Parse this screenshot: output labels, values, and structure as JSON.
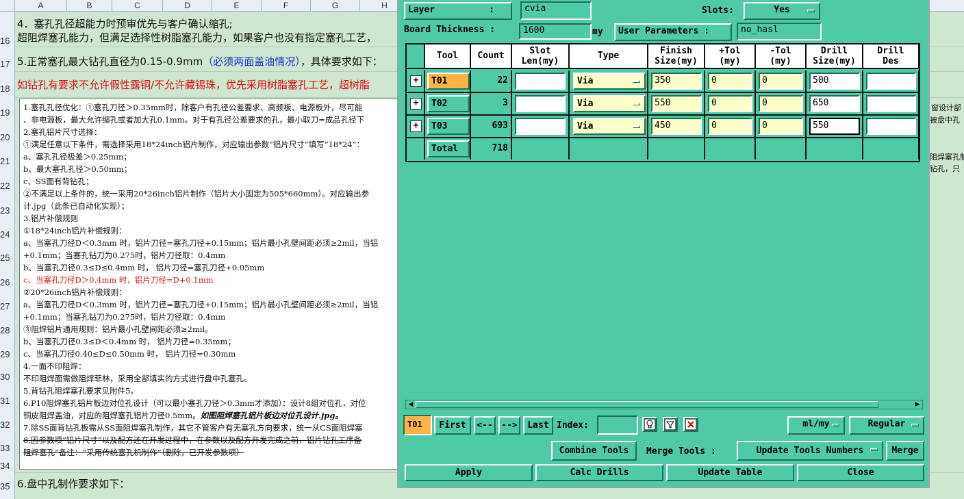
{
  "sheet": {
    "columns": [
      "A",
      "B",
      "C",
      "D",
      "E",
      "F",
      "G",
      "H"
    ],
    "rows": [
      "16",
      "17",
      "18",
      "19",
      "20",
      "21",
      "22",
      "23",
      "24",
      "25",
      "26",
      "27",
      "28",
      "29",
      "30",
      "31",
      "32",
      "33",
      "34",
      "35"
    ],
    "line1": "4．塞孔孔径超能力时预审优先与客户确认缩孔;",
    "line2": "超阻焊塞孔能力，但满足选择性树脂塞孔能力，如果客户也没有指定塞孔工艺，",
    "line3_a": "5.正常塞孔最大钻孔直径为0.15-0.9mm",
    "line3_b": "（必须两面盖油情况）",
    "line3_c": "，具体要求如下：",
    "line4": "如钻孔有要求不允许假性露铜/不允许藏锡珠，优先采用树脂塞孔工艺，超树脂",
    "line5": "6.盘中孔制作要求如下：",
    "notes": [
      "1.塞孔孔径优化：①塞孔刀径＞0.35mm时，除客户有孔径公差要求、高频板、电源板外，尽可能",
      "、非电源板，最大允许缩孔或者加大孔0.1mm。对于有孔径公差要求的孔，最小取刀=成品孔径下",
      "2.塞孔铝片尺寸选择：",
      "①满足任意以下条件，需选择采用18*24inch铝片制作，对应输出参数“铝片尺寸”填写“18*24”：",
      "a、塞孔孔径极差＞0.25mm；",
      "b、最大塞孔孔径＞0.50mm；",
      "c、SS面有背钻孔；",
      "②不满足以上条件的，统一采用20*26inch铝片制作（铝片大小固定为505*660mm）。对应输出参",
      "计.jpg（此条已自动化实现）；",
      "3.铝片补偿规则",
      "①18*24inch铝片补偿规则：",
      "a、当塞孔刀径D＜0.3mm 时，铝片刀径=塞孔刀径+0.15mm；铝片最小孔壁间距必须≥2mil，当铝",
      "+0.1mm；当塞孔钻刀为0.275时，铝片刀径取：0.4mm",
      "b、当塞孔刀径0.3≤D≤0.4mm 时， 铝片刀径=塞孔刀径+0.05mm",
      "c、当塞孔刀径D＞0.4mm 时，铝片刀径=D+0.1mm",
      "②20*26inch铝片补偿规则：",
      "a、当塞孔刀径D＜0.3mm 时，铝片刀径=塞孔刀径+0.15mm；铝片最小孔壁间距必须≥2mil，当铝",
      "+0.1mm；当塞孔钻刀为0.275时，铝片刀径取：0.4mm",
      "③阻焊铝片通用规则：铝片最小孔壁间距必须≥2mil。",
      "b、当塞孔刀径0.3≤D＜0.4mm 时， 铝片刀径=0.35mm；",
      "c、当塞孔刀径0.40≤D≤0.50mm 时， 铝片刀径=0.30mm",
      "4.一面不印阻焊：",
      "不印阻焊面需做阻焊菲林，采用全部填实的方式进行盘中孔塞孔。",
      "5.背钻孔阻焊塞孔要求见附件5。",
      "6.P10阻焊塞孔铝片板边对位孔设计（可以最小塞孔刀径＞0.3mm才添加）：设计8组对位孔，对位",
      "铜皮阻焊盖油，对应的阻焊塞孔铝片刀径0.5mm。",
      "如图阻焊塞孔铝片板边对位孔设计.jpg。",
      "7.除SS面背钻孔板需从SS面阻焊塞孔制作，其它不管客户有无塞孔方向要求，统一从CS面阻焊塞",
      "8.因参数项“铝片尺寸”以及配方还在开发过程中，在参数以及配方开发完成之前，铝片钻孔工序备",
      "阻焊塞孔”备注：“采用传统塞孔机制作”（删除，已开发参数项）"
    ],
    "right_texts": [
      "窗设计部",
      "被盘中孔",
      "阻焊塞孔制",
      "钻孔，只"
    ]
  },
  "dialog": {
    "layer_label": "Layer",
    "layer_value": "cvia",
    "slots_label": "Slots:",
    "slots_value": "Yes",
    "board_thickness_label": "Board Thickness :",
    "board_thickness_value": "1600",
    "board_thickness_unit": "my",
    "user_params_label": "User Parameters :",
    "user_params_value": "no_hasl",
    "table": {
      "headers": [
        "Tool",
        "Count",
        "Slot\nLen(my)",
        "Type",
        "Finish\nSize(my)",
        "+Tol\n(my)",
        "-Tol\n(my)",
        "Drill\nSize(my)",
        "Drill\nDes"
      ],
      "rows": [
        {
          "add": "+",
          "tool": "T01",
          "count": "22",
          "slot_len": "",
          "type": "Via",
          "finish": "350",
          "ptol": "0",
          "ntol": "0",
          "drill": "500",
          "des": ""
        },
        {
          "add": "+",
          "tool": "T02",
          "count": "3",
          "slot_len": "",
          "type": "Via",
          "finish": "550",
          "ptol": "0",
          "ntol": "0",
          "drill": "650",
          "des": ""
        },
        {
          "add": "+",
          "tool": "T03",
          "count": "693",
          "slot_len": "",
          "type": "Via",
          "finish": "450",
          "ptol": "0",
          "ntol": "0",
          "drill": "550",
          "des": ""
        }
      ],
      "total_label": "Total",
      "total_count": "718"
    },
    "nav": {
      "current_tool": "T01",
      "first": "First",
      "prev": "<--",
      "next": "-->",
      "last": "Last",
      "index_label": "Index:",
      "index_value": "",
      "units": "ml/my",
      "mode": "Regular"
    },
    "buttons": {
      "combine": "Combine Tools",
      "merge_label": "Merge Tools :",
      "update_numbers": "Update Tools Numbers",
      "merge": "Merge",
      "apply": "Apply",
      "calc": "Calc Drills",
      "update_table": "Update Table",
      "close": "Close"
    },
    "colors": {
      "panel": "#4fcaa6",
      "selected_tool": "#ffb347",
      "entry_yellow": "#ffffc8"
    }
  }
}
